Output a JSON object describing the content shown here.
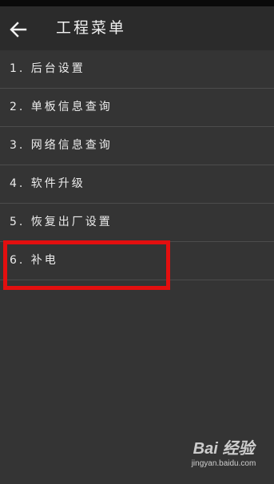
{
  "header": {
    "title": "工程菜单",
    "back_icon": "arrow-left-icon"
  },
  "menu": {
    "items": [
      {
        "label": "1. 后台设置"
      },
      {
        "label": "2. 单板信息查询"
      },
      {
        "label": "3. 网络信息查询"
      },
      {
        "label": "4. 软件升级"
      },
      {
        "label": "5. 恢复出厂设置"
      },
      {
        "label": "6. 补电"
      }
    ]
  },
  "highlight": {
    "color": "#e30f0f",
    "target": "6. 补电"
  },
  "watermark": {
    "logo": "Bai 经验",
    "url": "jingyan.baidu.com"
  },
  "colors": {
    "background": "#343434",
    "app_bar": "#2b2b2b",
    "divider": "#4c4c4c"
  }
}
